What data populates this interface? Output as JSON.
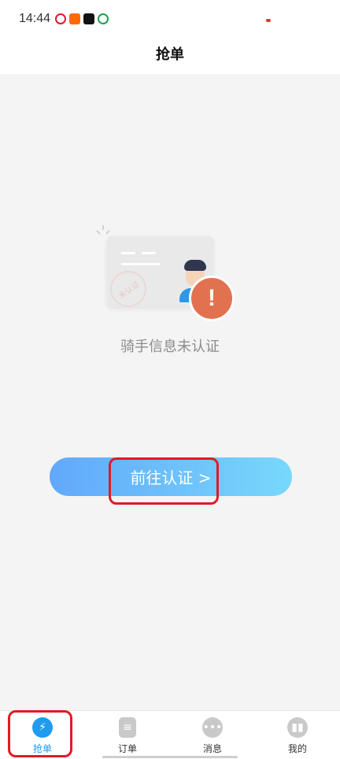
{
  "status_bar": {
    "time": "14:44",
    "icons": [
      "weibo-icon",
      "app-icon",
      "tiktok-icon",
      "app-icon"
    ]
  },
  "header": {
    "title": "抢单"
  },
  "main": {
    "illustration": {
      "stamp_text": "未认证",
      "warning_glyph": "!"
    },
    "status_text": "骑手信息未认证",
    "verify_button": "前往认证 >"
  },
  "tabbar": {
    "items": [
      {
        "label": "抢单",
        "icon": "lightning-clock-icon",
        "active": true
      },
      {
        "label": "订单",
        "icon": "document-icon",
        "active": false
      },
      {
        "label": "消息",
        "icon": "chat-bubble-icon",
        "active": false
      },
      {
        "label": "我的",
        "icon": "profile-icon",
        "active": false
      }
    ]
  },
  "colors": {
    "accent": "#1f9bf0",
    "button_gradient_start": "#62a8fb",
    "button_gradient_end": "#78d8fb",
    "warning": "#e2714f",
    "highlight": "#e01b24"
  }
}
